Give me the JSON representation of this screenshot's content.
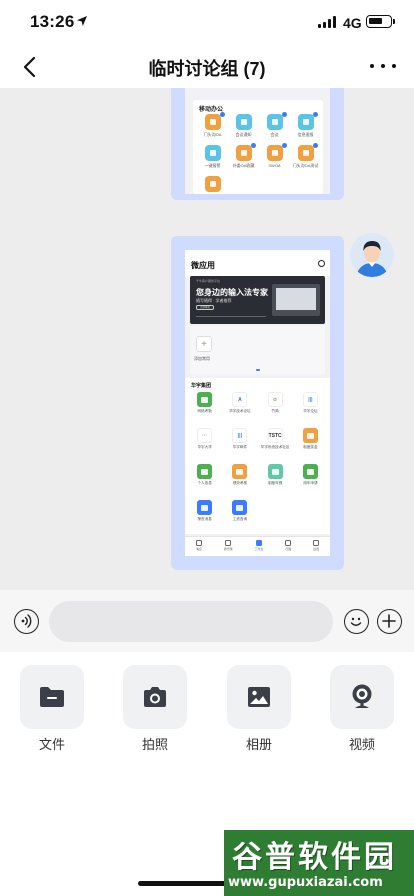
{
  "status_bar": {
    "time": "13:26",
    "network": "4G",
    "battery_level": 0.7
  },
  "nav": {
    "title": "临时讨论组 (7)",
    "back_icon": "chevron-left-icon",
    "more_icon": "more-dots-icon"
  },
  "messages": [
    {
      "type": "image",
      "section_title": "移动办公",
      "apps": [
        {
          "label": "门头沟OA",
          "color": "#f0a040",
          "badge": true
        },
        {
          "label": "会议通知",
          "color": "#5cc3e8",
          "badge": false
        },
        {
          "label": "会议",
          "color": "#5cc3e8",
          "badge": true
        },
        {
          "label": "信息速报",
          "color": "#5cc3e8",
          "badge": true
        },
        {
          "label": "一键报警",
          "color": "#5cc3e8",
          "badge": false
        },
        {
          "label": "外委OA收藏",
          "color": "#f0a040",
          "badge": true
        },
        {
          "label": "SWOA",
          "color": "#f0a040",
          "badge": true
        },
        {
          "label": "门头沟OA测试",
          "color": "#f0a040",
          "badge": true
        },
        {
          "label": "",
          "color": "#f0a040",
          "badge": false
        }
      ]
    },
    {
      "type": "image",
      "title": "微应用",
      "banner": {
        "small_text": "千牛客户服务平台",
        "title": "您身边的输入法专家",
        "subtitle": "随写随得 · 学者推荐",
        "button": "立即体验"
      },
      "add_label": "添加常用",
      "group_title": "华宇集团",
      "apps": [
        {
          "label": "网络考勤",
          "color": "#4caf50",
          "glyph": ""
        },
        {
          "label": "华宇技术论坛",
          "color": "#ffffff",
          "glyph": "A",
          "glyph_color": "#2f6fe0"
        },
        {
          "label": "竹简",
          "color": "#ffffff",
          "glyph": "⊘",
          "glyph_color": "#5fb85f"
        },
        {
          "label": "华宇论坛",
          "color": "#ffffff",
          "glyph": "|||",
          "glyph_color": "#3a7bff"
        },
        {
          "label": "华宇大学",
          "color": "#ffffff",
          "glyph": "···",
          "glyph_color": "#999999"
        },
        {
          "label": "华宇邮件",
          "color": "#ffffff",
          "glyph": "|||",
          "glyph_color": "#3a7bff"
        },
        {
          "label": "华宇系统技术社区",
          "color": "#ffffff",
          "glyph": "TSTC",
          "glyph_color": "#333333"
        },
        {
          "label": "制度奖金",
          "color": "#f0a040",
          "glyph": ""
        },
        {
          "label": "个人信息",
          "color": "#4caf50",
          "glyph": ""
        },
        {
          "label": "绩效考核",
          "color": "#f0a040",
          "glyph": ""
        },
        {
          "label": "制度年假",
          "color": "#5fc8a8",
          "glyph": ""
        },
        {
          "label": "用车申请",
          "color": "#4caf50",
          "glyph": ""
        },
        {
          "label": "筛查消息",
          "color": "#3a7bff",
          "glyph": ""
        },
        {
          "label": "工资查询",
          "color": "#3a7bff",
          "glyph": ""
        }
      ],
      "tabbar": [
        {
          "label": "消息",
          "active": false
        },
        {
          "label": "通讯录",
          "active": false
        },
        {
          "label": "工作台",
          "active": true
        },
        {
          "label": "日程",
          "active": false
        },
        {
          "label": "设置",
          "active": false
        }
      ]
    }
  ],
  "input": {
    "value": "",
    "placeholder": ""
  },
  "tools": [
    {
      "label": "文件",
      "icon": "folder-icon"
    },
    {
      "label": "拍照",
      "icon": "camera-icon"
    },
    {
      "label": "相册",
      "icon": "image-icon"
    },
    {
      "label": "视频",
      "icon": "webcam-icon"
    }
  ],
  "watermark": {
    "title": "谷普软件园",
    "url": "www.gupuxiazai.com"
  }
}
